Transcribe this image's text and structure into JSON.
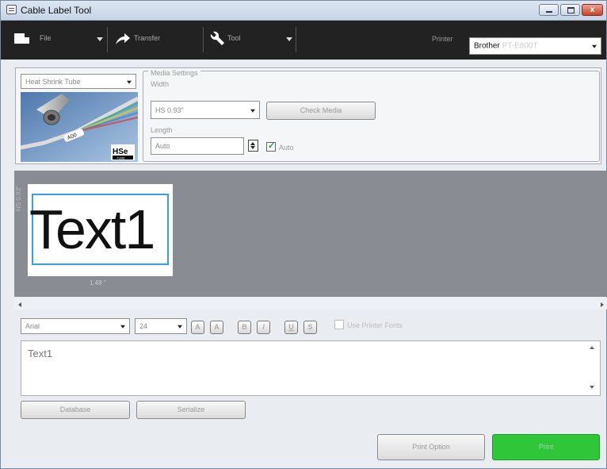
{
  "window": {
    "title": "Cable Label Tool",
    "close_glyph": "x"
  },
  "toolbar": {
    "file_label": "File",
    "transfer_label": "Transfer",
    "tool_label": "Tool",
    "printer_label": "Printer",
    "printer_value": "Brother",
    "printer_model": "PT-E800T"
  },
  "media": {
    "type_value": "Heat Shrink Tube",
    "settings_legend": "Media Settings",
    "width_label": "Width",
    "width_value": "HS 0.93\"",
    "check_media_label": "Check Media",
    "length_label": "Length",
    "length_value": "Auto",
    "auto_label": "Auto",
    "auto_checked": true,
    "image": {
      "tag": "A00",
      "brand": "HSe",
      "brand_sub": "TUBE"
    }
  },
  "preview": {
    "label_text": "Text1",
    "height_dim": "HS 0.93\"",
    "length_dim": "1.48 \""
  },
  "format": {
    "font_value": "Arial",
    "size_value": "24",
    "buttons": [
      "A",
      "A",
      "B",
      "I",
      "U",
      "S"
    ],
    "use_printer_fonts_label": "Use Printer Fonts"
  },
  "editor": {
    "text": "Text1"
  },
  "actions": {
    "database_label": "Database",
    "serialize_label": "Serialize",
    "print_option_label": "Print Option",
    "print_label": "Print"
  },
  "colors": {
    "accent": "#2fc63a",
    "toolbar_bg": "#222222",
    "preview_bg": "#898d93",
    "selection": "#39a0e0"
  }
}
